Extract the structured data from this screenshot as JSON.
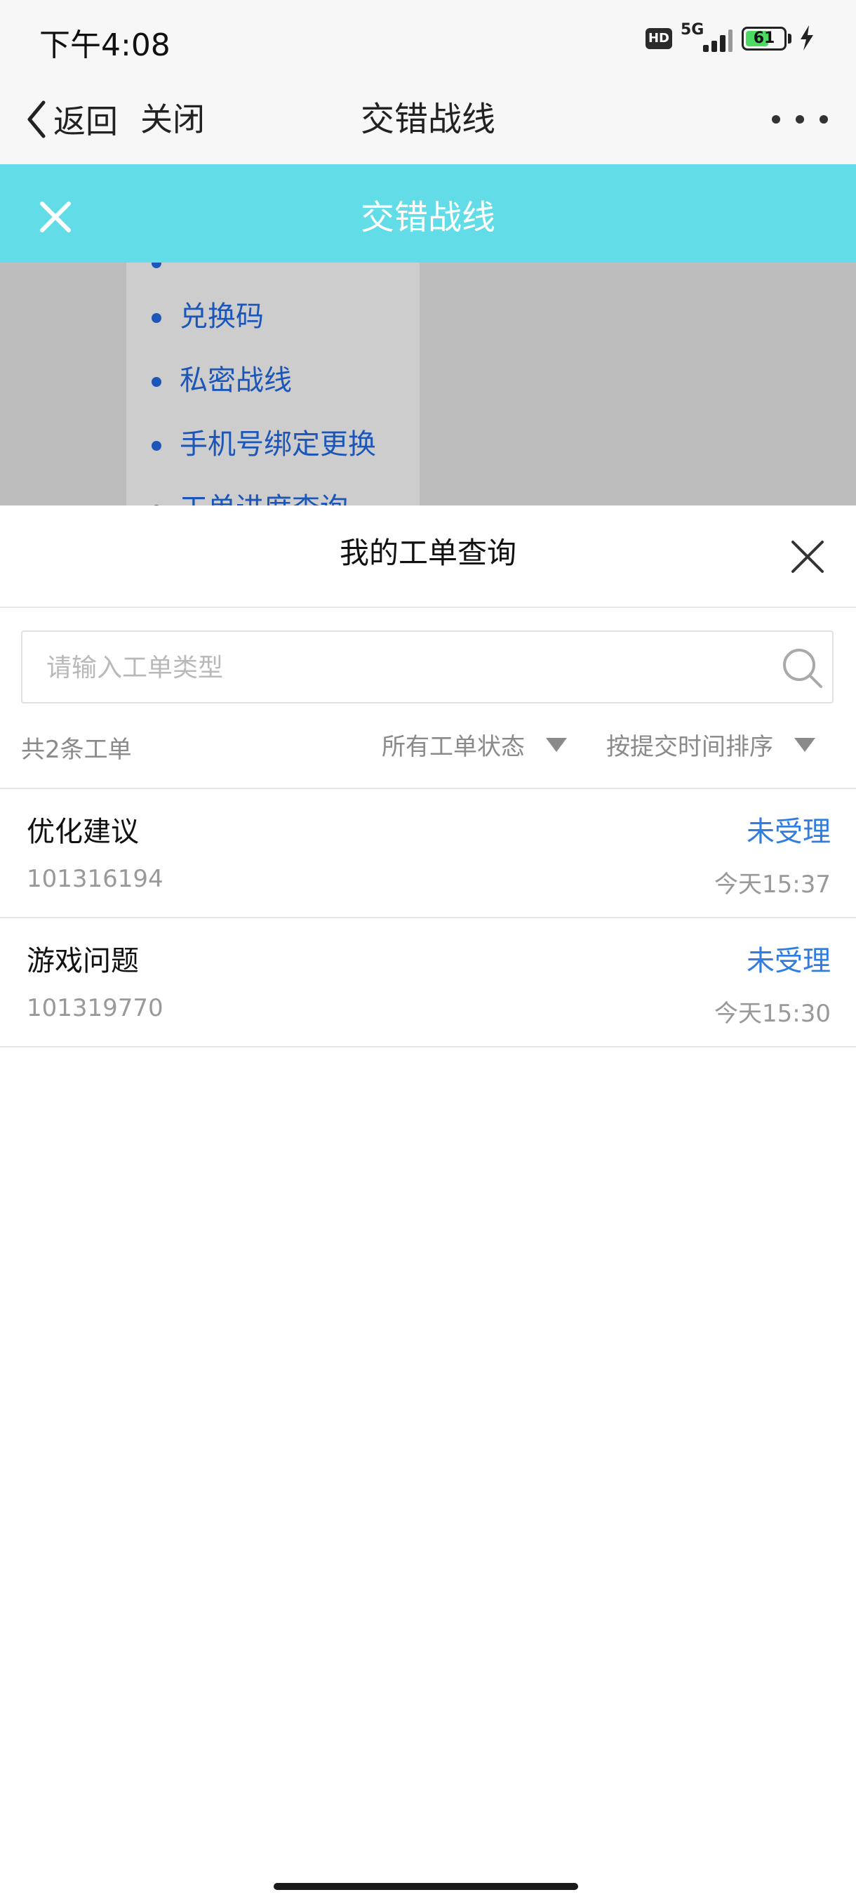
{
  "status_bar": {
    "time": "下午4:08",
    "hd_label": "HD",
    "network": "5G",
    "battery_level": "61",
    "battery_fraction": 0.61,
    "battery_color": "#4cd964"
  },
  "header": {
    "back_label": "返回",
    "close_label": "关闭",
    "title": "交错战线",
    "more_icon": "more-horizontal-icon"
  },
  "page_header": {
    "title": "交错战线",
    "background_color": "#62dde8",
    "close_icon": "close-icon"
  },
  "background_menu": {
    "items": [
      {
        "label": "兑换码"
      },
      {
        "label": "私密战线"
      },
      {
        "label": "手机号绑定更换"
      },
      {
        "label": "工单进度查询"
      }
    ],
    "link_color": "#1c56b8"
  },
  "sheet": {
    "title": "我的工单查询",
    "close_icon": "close-icon",
    "search": {
      "placeholder": "请输入工单类型",
      "value": "",
      "icon": "search-icon"
    },
    "count_text": "共2条工单",
    "filters": {
      "status_label": "所有工单状态",
      "sort_label": "按提交时间排序"
    },
    "tickets": [
      {
        "type": "优化建议",
        "id": "101316194",
        "status": "未受理",
        "time": "今天15:37"
      },
      {
        "type": "游戏问题",
        "id": "101319770",
        "status": "未受理",
        "time": "今天15:30"
      }
    ],
    "status_color": "#2f7de1"
  }
}
